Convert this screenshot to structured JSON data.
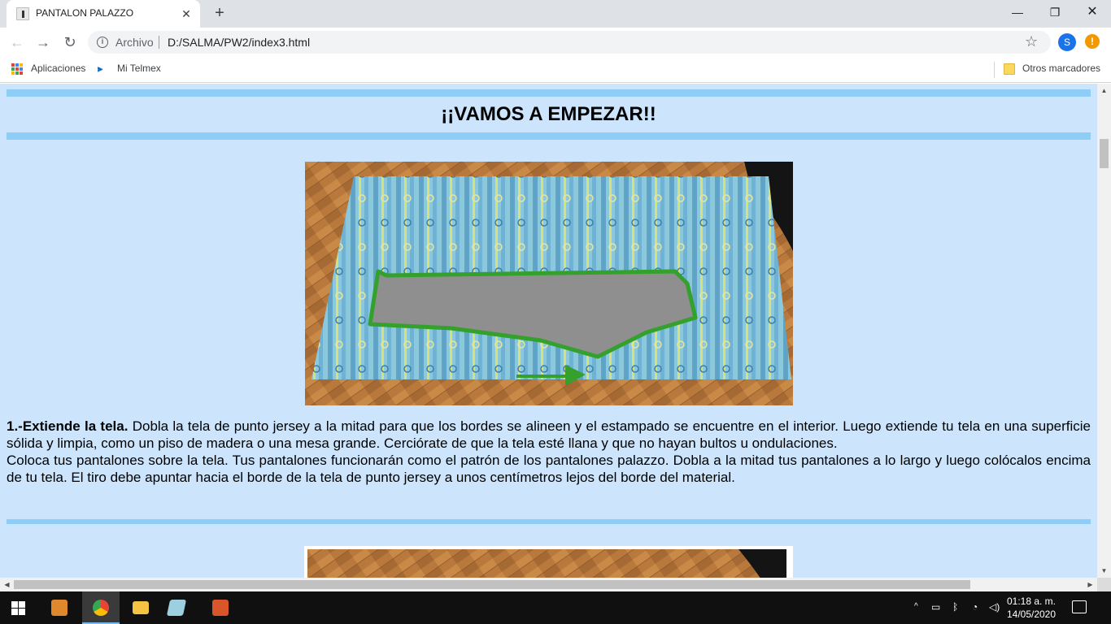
{
  "browser": {
    "tab_title": "PANTALON PALAZZO",
    "tab_close": "✕",
    "new_tab": "+",
    "window_min": "—",
    "window_max": "❐",
    "window_close": "✕",
    "nav_back": "←",
    "nav_forward": "→",
    "nav_reload": "↻",
    "omnibox_security_label": "Archivo",
    "url": "D:/SALMA/PW2/index3.html",
    "star": "☆",
    "profile_initial": "S",
    "alert": "!"
  },
  "bookmarks": {
    "apps_label": "Aplicaciones",
    "telmex_label": "Mi Telmex",
    "other_label": "Otros marcadores"
  },
  "page": {
    "heading": "¡¡VAMOS A EMPEZAR!!",
    "step1": {
      "title": "1.-Extiende la tela.",
      "body": " Dobla la tela de punto jersey a la mitad para que los bordes se alineen y el estampado se encuentre en el interior. Luego extiende tu tela en una superficie sólida y limpia, como un piso de madera o una mesa grande. Cerciórate de que la tela esté llana y que no hayan bultos u ondulaciones.",
      "paragraph2": "Coloca tus pantalones sobre la tela. Tus pantalones funcionarán como el patrón de los pantalones palazzo. Dobla a la mitad tus pantalones a lo largo y luego colócalos encima de tu tela. El tiro debe apuntar hacia el borde de la tela de punto jersey a unos centímetros lejos del borde del material."
    },
    "colors": {
      "background": "#cce5fc",
      "bar": "#8ecdf5"
    }
  },
  "taskbar": {
    "clock_time": "01:18 a. m.",
    "clock_date": "14/05/2020",
    "tray_up": "^"
  }
}
